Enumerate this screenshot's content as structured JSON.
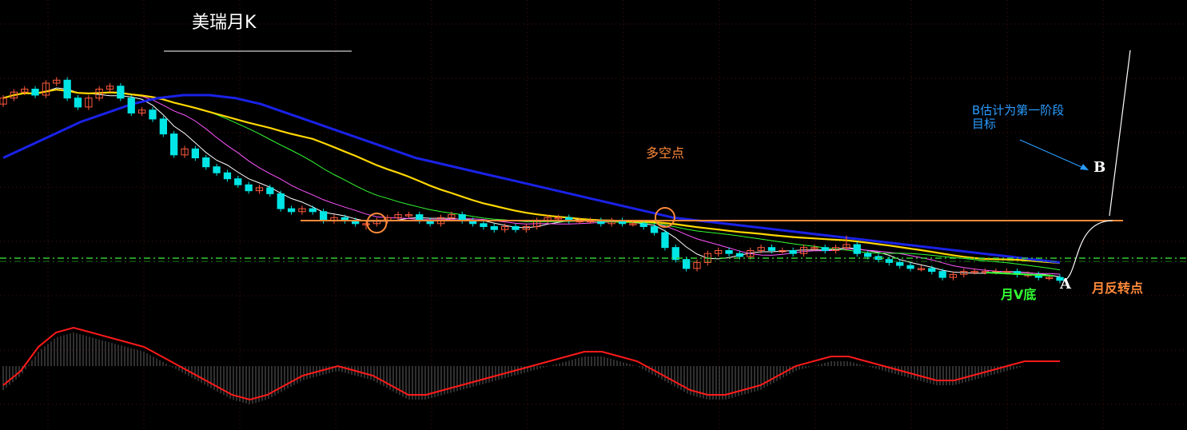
{
  "title": "美瑞月K",
  "annotations": {
    "target_text_line1": "B估计为第一阶段",
    "target_text_line2": "目标",
    "duo_kong": "多空点",
    "v_bottom": "月V底",
    "reversal": "月反转点",
    "point_a": "A",
    "point_b": "B"
  },
  "colors": {
    "background": "#000000",
    "up_candle": "#ff5a3c",
    "down_candle": "#00e5e5",
    "ma_fast": "#ffffff",
    "ma_mid": "#ffd700",
    "ma_slow": "#1a22e6",
    "ma_thin_1": "#ff55ff",
    "ma_thin_2": "#33ff33",
    "resistance": "#ff8a3a",
    "support": "#33cc33",
    "macd": "#ff1a1a",
    "grid": "#4b0f0f",
    "title": "#ffffff",
    "target_text": "#2a9cff",
    "duo_kong": "#ff8a3a",
    "v_bottom": "#33ff33",
    "reversal": "#ff8a3a"
  },
  "chart_data": {
    "type": "candlestick",
    "title": "美瑞月K",
    "axes": "none",
    "grid": "dotted",
    "legend": "none",
    "ylim": [
      0,
      100
    ],
    "series": [
      {
        "kind": "candles",
        "open": [
          70,
          72,
          74,
          75,
          73,
          77,
          78,
          72,
          69,
          72,
          75,
          76,
          72,
          67,
          68,
          65,
          60,
          53,
          55,
          52,
          49,
          47,
          45,
          43,
          41,
          42,
          40,
          35,
          34,
          35,
          34,
          31,
          32,
          31,
          30,
          30,
          31,
          32,
          33,
          33,
          31,
          30,
          32,
          33,
          31,
          30,
          29,
          28,
          29,
          28,
          29,
          31,
          32,
          32,
          31,
          31,
          31,
          30,
          31,
          30,
          30,
          29,
          27,
          22,
          18,
          15,
          17,
          20,
          21,
          20,
          19,
          21,
          22,
          21,
          21,
          20,
          22,
          22,
          21,
          22,
          23,
          20,
          19,
          18,
          17,
          16,
          15,
          15,
          14,
          12,
          13,
          14,
          14,
          14,
          14,
          14,
          13,
          13,
          12,
          12
        ],
        "close": [
          72,
          74,
          75,
          73,
          77,
          78,
          72,
          69,
          72,
          75,
          76,
          72,
          67,
          68,
          65,
          60,
          53,
          55,
          52,
          49,
          47,
          45,
          43,
          41,
          42,
          40,
          35,
          34,
          35,
          34,
          31,
          32,
          31,
          30,
          30,
          31,
          32,
          33,
          33,
          31,
          30,
          32,
          33,
          31,
          30,
          29,
          28,
          29,
          28,
          29,
          31,
          32,
          32,
          31,
          31,
          31,
          30,
          31,
          30,
          30,
          29,
          27,
          22,
          18,
          15,
          17,
          20,
          21,
          20,
          19,
          21,
          22,
          21,
          21,
          20,
          22,
          22,
          21,
          22,
          23,
          20,
          19,
          18,
          17,
          16,
          15,
          15,
          14,
          12,
          13,
          14,
          14,
          14,
          14,
          14,
          13,
          13,
          12,
          12,
          11
        ],
        "high": [
          73,
          75,
          76,
          76,
          78,
          79,
          79,
          73,
          73,
          76,
          77,
          77,
          73,
          69,
          69,
          66,
          61,
          56,
          56,
          53,
          50,
          48,
          46,
          44,
          43,
          43,
          41,
          36,
          36,
          36,
          35,
          33,
          33,
          32,
          31,
          32,
          33,
          34,
          34,
          34,
          32,
          33,
          34,
          34,
          32,
          31,
          30,
          30,
          30,
          30,
          32,
          33,
          33,
          33,
          32,
          32,
          32,
          32,
          32,
          31,
          31,
          30,
          28,
          23,
          19,
          18,
          21,
          22,
          22,
          21,
          22,
          23,
          23,
          22,
          22,
          23,
          23,
          23,
          23,
          26,
          24,
          21,
          20,
          19,
          18,
          17,
          16,
          16,
          15,
          14,
          15,
          15,
          15,
          15,
          15,
          15,
          14,
          14,
          13,
          13
        ],
        "low": [
          69,
          71,
          73,
          72,
          72,
          76,
          71,
          68,
          68,
          71,
          74,
          71,
          66,
          66,
          64,
          59,
          52,
          52,
          51,
          48,
          46,
          44,
          42,
          40,
          40,
          39,
          34,
          33,
          33,
          33,
          30,
          30,
          30,
          29,
          28,
          29,
          30,
          31,
          32,
          30,
          29,
          29,
          31,
          30,
          29,
          28,
          27,
          27,
          27,
          27,
          28,
          30,
          31,
          30,
          30,
          30,
          29,
          29,
          29,
          29,
          28,
          26,
          21,
          17,
          14,
          14,
          16,
          19,
          19,
          18,
          18,
          20,
          20,
          20,
          19,
          19,
          21,
          20,
          20,
          21,
          19,
          18,
          17,
          16,
          15,
          14,
          14,
          13,
          11,
          11,
          12,
          13,
          13,
          13,
          13,
          12,
          12,
          11,
          11,
          10
        ]
      },
      {
        "name": "",
        "kind": "ma",
        "period": 5,
        "color": "#ffffff"
      },
      {
        "name": "",
        "kind": "ma",
        "period": 10,
        "color": "#ff55ff"
      },
      {
        "name": "",
        "kind": "ma",
        "period": 20,
        "color": "#33ff33"
      },
      {
        "name": "",
        "kind": "ma",
        "period": 30,
        "color": "#ffd700"
      },
      {
        "name": "",
        "kind": "ma_manual",
        "color": "#1a22e6",
        "values": [
          52,
          56,
          60,
          64,
          67,
          70,
          72,
          73,
          73,
          72,
          70,
          67,
          64,
          61,
          58,
          55,
          52,
          50,
          48,
          46,
          44,
          42,
          40,
          38,
          36,
          34,
          32,
          31,
          30,
          29,
          28,
          27,
          26,
          25,
          24,
          23,
          22,
          21,
          20,
          19,
          18,
          17
        ]
      }
    ],
    "resistance_level": 31,
    "support_level": 12,
    "macd": {
      "line": [
        -5,
        -2,
        3,
        6,
        7,
        6,
        5,
        4,
        3,
        1,
        -1,
        -3,
        -5,
        -7,
        -8,
        -7,
        -5,
        -3,
        -2,
        -1,
        -2,
        -3,
        -5,
        -7,
        -7,
        -6,
        -5,
        -4,
        -3,
        -2,
        -1,
        0,
        1,
        2,
        2,
        1,
        0,
        -2,
        -4,
        -6,
        -7,
        -7,
        -6,
        -5,
        -3,
        -1,
        0,
        1,
        1,
        0,
        -1,
        -2,
        -3,
        -4,
        -4,
        -3,
        -2,
        -1,
        0,
        0,
        0
      ]
    },
    "projection": {
      "start_index": 99,
      "target_value": 31,
      "extension_value": 88
    }
  }
}
